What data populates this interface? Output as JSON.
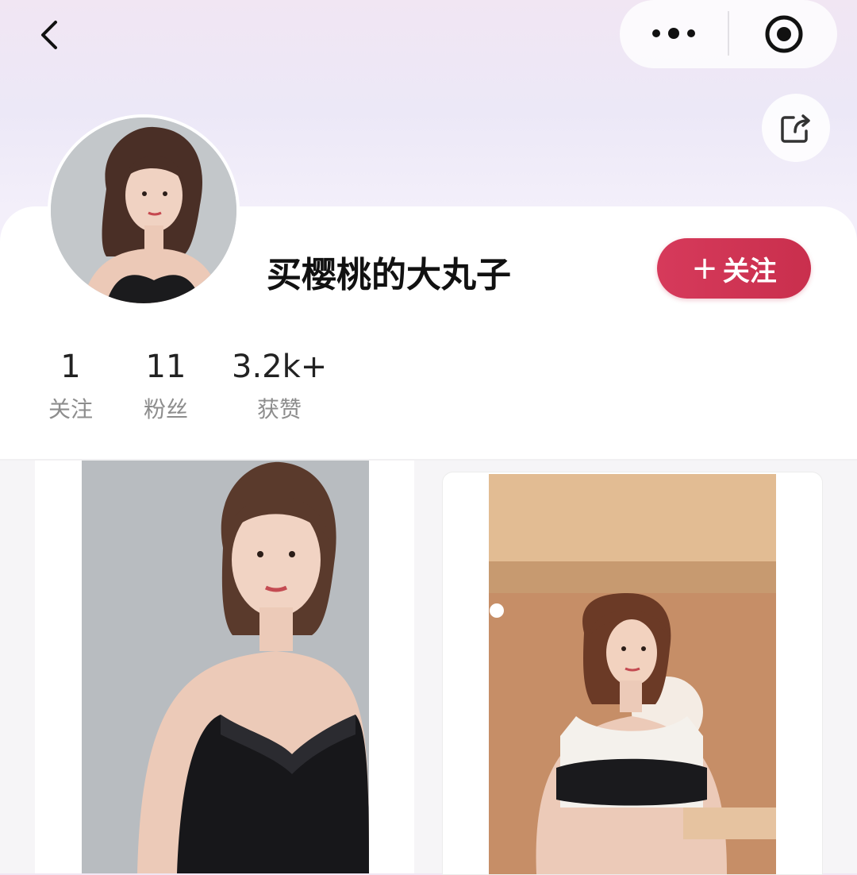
{
  "nav": {
    "back_icon": "chevron-left-icon",
    "more_icon": "more-dots-icon",
    "close_icon": "target-circle-icon"
  },
  "share": {
    "icon": "share-icon"
  },
  "profile": {
    "nickname": "买樱桃的大丸子",
    "follow_plus": "+",
    "follow_label": "关注",
    "avatar": "user-avatar-photo"
  },
  "stats": [
    {
      "value": "1",
      "label": "关注"
    },
    {
      "value": "11",
      "label": "粉丝"
    },
    {
      "value": "3.2k+",
      "label": "获赞"
    }
  ],
  "posts": [
    {
      "image": "woman-black-lace-camisole-photo"
    },
    {
      "image": "woman-sports-bra-photo"
    }
  ],
  "colors": {
    "accent": "#d33658",
    "label_gray": "#8d8d8d"
  }
}
